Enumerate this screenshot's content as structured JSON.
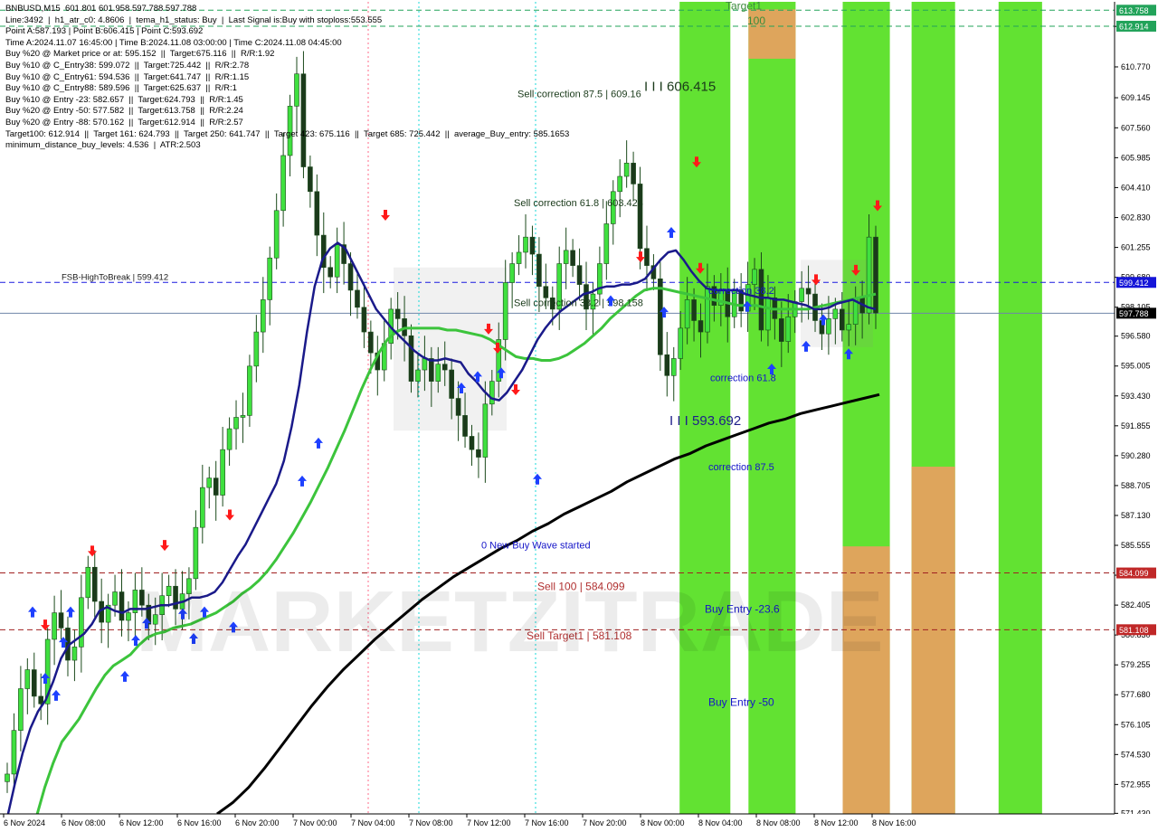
{
  "info_panel": {
    "lines": [
      "BNBUSD,M15  601.801 601.958 597.788 597.788",
      "Line:3492  |  h1_atr_c0: 4.8606  |  tema_h1_status: Buy  |  Last Signal is:Buy with stoploss:553.555",
      "Point A:587.193 | Point B:606.415 | Point C:593.692",
      "Time A:2024.11.07 16:45:00 | Time B:2024.11.08 03:00:00 | Time C:2024.11.08 04:45:00",
      "Buy %20 @ Market price or at: 595.152  ||  Target:675.116  ||  R/R:1.92",
      "Buy %10 @ C_Entry38: 599.072  ||  Target:725.442  ||  R/R:2.78",
      "Buy %10 @ C_Entry61: 594.536  ||  Target:641.747  ||  R/R:1.15",
      "Buy %10 @ C_Entry88: 589.596  ||  Target:625.637  ||  R/R:1",
      "Buy %10 @ Entry -23: 582.657  ||  Target:624.793  ||  R/R:1.45",
      "Buy %20 @ Entry -50: 577.582  ||  Target:613.758  ||  R/R:2.24",
      "Buy %20 @ Entry -88: 570.162  ||  Target:612.914  ||  R/R:2.57",
      "Target100: 612.914  ||  Target 161: 624.793  ||  Target 250: 641.747  ||  Target 423: 675.116  ||  Target 685: 725.442  ||  average_Buy_entry: 585.1653",
      "minimum_distance_buy_levels: 4.536  |  ATR:2.503"
    ]
  },
  "chart_data": {
    "type": "candlestick",
    "symbol": "BNBUSD,M15",
    "ylim": [
      571.4,
      614.2
    ],
    "x_ticks": [
      "6 Nov 2024",
      "6 Nov 08:00",
      "6 Nov 12:00",
      "6 Nov 16:00",
      "6 Nov 20:00",
      "7 Nov 00:00",
      "7 Nov 04:00",
      "7 Nov 08:00",
      "7 Nov 12:00",
      "7 Nov 16:00",
      "7 Nov 20:00",
      "8 Nov 00:00",
      "8 Nov 04:00",
      "8 Nov 08:00",
      "8 Nov 12:00",
      "8 Nov 16:00"
    ],
    "y_ticks": [
      "612.905",
      "610.770",
      "609.145",
      "607.560",
      "605.985",
      "604.410",
      "602.830",
      "601.255",
      "599.680",
      "598.105",
      "596.580",
      "595.005",
      "593.430",
      "591.855",
      "590.280",
      "588.705",
      "587.130",
      "585.555",
      "583.980",
      "582.405",
      "580.830",
      "579.255",
      "577.680",
      "576.105",
      "574.530",
      "572.955",
      "571.430"
    ],
    "price_tags": [
      {
        "value": 613.758,
        "label": "613.758",
        "color": "#22a35a"
      },
      {
        "value": 612.914,
        "label": "612.914",
        "color": "#22a35a"
      },
      {
        "value": 599.412,
        "label": "599.412",
        "color": "#1515d8"
      },
      {
        "value": 597.788,
        "label": "597.788",
        "color": "#000000"
      },
      {
        "value": 584.099,
        "label": "584.099",
        "color": "#c02828"
      },
      {
        "value": 581.108,
        "label": "581.108",
        "color": "#c02828"
      }
    ],
    "levels": [
      {
        "value": 613.758,
        "style": "dashed",
        "color": "#22a35a"
      },
      {
        "value": 612.914,
        "style": "dashed",
        "color": "#22a35a"
      },
      {
        "value": 599.412,
        "style": "dashed",
        "color": "#1a1ae0",
        "label": "FSB-HighToBreak | 599.412"
      },
      {
        "value": 597.788,
        "style": "solid",
        "color": "#6f86a8"
      },
      {
        "value": 584.099,
        "style": "dashed",
        "color": "#a02020"
      },
      {
        "value": 581.108,
        "style": "dashed",
        "color": "#a02020"
      }
    ],
    "annotations": [
      {
        "text": "Sell correction 87.5 | 609.16",
        "price": 609.16,
        "color": "#1a3a1a",
        "size": 11
      },
      {
        "text": "Sell correction 61.8 | 603.424",
        "price": 603.424,
        "color": "#1a3a1a",
        "size": 11
      },
      {
        "text": "Sell correction 38.2 | 598.158",
        "price": 598.158,
        "color": "#1a3a1a",
        "size": 11
      },
      {
        "text": "I I I 606.415",
        "price": 609.5,
        "color": "#1a3a1a",
        "size": 15
      },
      {
        "text": "I I I 593.692",
        "price": 591.9,
        "color": "#1e1e8a",
        "size": 15
      },
      {
        "text": "Target1",
        "price": 613.8,
        "color": "#3c8c3c",
        "size": 12
      },
      {
        "text": "100",
        "price": 613.0,
        "color": "#3c8c3c",
        "size": 12
      },
      {
        "text": "correction 38.2",
        "price": 598.8,
        "color": "#1515c8",
        "size": 11
      },
      {
        "text": "correction 61.8",
        "price": 594.2,
        "color": "#1515c8",
        "size": 11
      },
      {
        "text": "correction 87.5",
        "price": 589.5,
        "color": "#1515c8",
        "size": 11
      },
      {
        "text": "0 New Buy Wave started",
        "price": 585.4,
        "color": "#1515c8",
        "size": 11
      },
      {
        "text": "Sell 100 | 584.099",
        "price": 583.2,
        "color": "#b03030",
        "size": 12
      },
      {
        "text": "Sell Target1 | 581.108",
        "price": 580.6,
        "color": "#b03030",
        "size": 12
      },
      {
        "text": "Buy Entry -23.6",
        "price": 582.0,
        "color": "#1515c8",
        "size": 12
      },
      {
        "text": "Buy Entry -50",
        "price": 577.1,
        "color": "#1515c8",
        "size": 12
      }
    ],
    "zones": [
      {
        "from": 9,
        "to": 9.7,
        "color": "#55e021"
      },
      {
        "from": 9.95,
        "to": 10.6,
        "color": "#55e021"
      },
      {
        "from": 11.25,
        "to": 11.9,
        "color": "#55e021"
      },
      {
        "from": 12.2,
        "to": 12.8,
        "color": "#55e021"
      },
      {
        "from": 13.4,
        "to": 14.0,
        "color": "#55e021"
      },
      {
        "from": 9.95,
        "to": 10.6,
        "color": "#e8a060",
        "top": 613.8,
        "bottom": 611.2
      },
      {
        "from": 11.25,
        "to": 11.9,
        "color": "#e8a060",
        "top": 585.5,
        "bottom": 571.4
      },
      {
        "from": 12.2,
        "to": 12.8,
        "color": "#e8a060",
        "top": 589.7,
        "bottom": 571.4
      }
    ],
    "close": [
      573.5,
      575.8,
      578.0,
      579.0,
      577.6,
      577.2,
      580.6,
      582.0,
      581.2,
      579.5,
      580.2,
      582.8,
      584.4,
      582.6,
      581.5,
      582.4,
      583.1,
      581.6,
      582.0,
      583.2,
      582.4,
      581.4,
      581.9,
      582.9,
      583.4,
      582.2,
      583.0,
      583.8,
      586.5,
      588.6,
      589.1,
      588.2,
      590.6,
      591.7,
      592.3,
      592.4,
      595.0,
      596.8,
      598.5,
      600.7,
      603.2,
      606.1,
      608.7,
      610.4,
      605.5,
      604.2,
      601.9,
      600.2,
      599.7,
      601.4,
      600.4,
      599.0,
      598.1,
      596.8,
      595.7,
      594.8,
      596.2,
      598.0,
      597.5,
      596.6,
      594.2,
      594.8,
      595.4,
      594.2,
      595.1,
      594.8,
      593.3,
      592.4,
      591.3,
      590.6,
      590.2,
      593.0,
      594.2,
      596.4,
      599.4,
      600.4,
      601.0,
      601.8,
      600.9,
      599.2,
      598.6,
      598.0,
      600.4,
      601.1,
      600.3,
      599.3,
      598.0,
      598.8,
      600.4,
      602.5,
      604.2,
      605.0,
      605.7,
      604.6,
      601.2,
      600.3,
      599.6,
      595.6,
      594.5,
      595.4,
      597.0,
      598.5,
      597.4,
      596.8,
      599.2,
      598.2,
      599.0,
      597.6,
      599.0,
      597.9,
      599.3,
      600.1,
      596.9,
      598.6,
      597.5,
      596.3,
      597.6,
      598.4,
      599.1,
      598.8,
      597.4,
      596.7,
      597.5,
      598.0,
      596.9,
      597.2,
      598.6,
      597.8,
      601.8,
      597.8
    ],
    "tema_line": [
      571.2,
      573.0,
      574.6,
      575.9,
      576.8,
      577.4,
      578.4,
      579.6,
      580.3,
      580.6,
      580.9,
      581.4,
      582.1,
      582.3,
      582.1,
      582.0,
      582.2,
      582.2,
      582.2,
      582.3,
      582.4,
      582.4,
      582.5,
      582.6,
      582.8,
      582.8,
      582.9,
      583.1,
      583.6,
      584.3,
      585.0,
      585.6,
      586.4,
      587.2,
      588.0,
      588.8,
      590.0,
      591.8,
      594.0,
      596.8,
      599.2,
      600.6,
      601.2,
      601.5,
      601.2,
      600.4,
      599.6,
      598.8,
      598.0,
      597.5,
      597.0,
      596.6,
      596.2,
      595.8,
      595.5,
      595.3,
      595.3,
      595.4,
      595.3,
      595.2,
      594.6,
      594.2,
      593.7,
      593.3,
      593.2,
      593.6,
      594.2,
      594.8,
      595.6,
      596.4,
      597.0,
      597.5,
      597.9,
      598.2,
      598.5,
      598.8,
      598.9,
      599.1,
      599.2,
      599.2,
      599.3,
      599.3,
      599.4,
      599.6,
      600.1,
      600.6,
      601.0,
      601.1,
      600.6,
      600.0,
      599.5,
      599.1,
      599.0,
      599.0,
      599.0,
      599.0,
      598.8,
      598.7,
      598.6,
      598.6,
      598.5,
      598.5,
      598.4,
      598.3,
      598.2,
      598.0,
      598.0,
      598.1,
      598.3,
      598.4,
      598.5,
      598.3,
      598.1,
      598.0
    ],
    "green_ma": [
      571.2,
      572.8,
      574.1,
      575.2,
      575.8,
      576.4,
      577.2,
      578.0,
      578.7,
      579.2,
      579.5,
      579.8,
      580.3,
      580.7,
      580.9,
      581.0,
      581.2,
      581.3,
      581.4,
      581.6,
      581.8,
      582.0,
      582.3,
      582.6,
      583.0,
      583.3,
      583.7,
      584.2,
      584.8,
      585.5,
      586.2,
      587.0,
      587.8,
      588.7,
      589.6,
      590.6,
      591.6,
      592.7,
      593.8,
      594.8,
      595.7,
      596.4,
      596.8,
      597.0,
      597.0,
      597.0,
      597.0,
      597.0,
      596.9,
      596.9,
      596.8,
      596.7,
      596.6,
      596.4,
      596.1,
      595.8,
      595.5,
      595.4,
      595.4,
      595.3,
      595.3,
      595.4,
      595.6,
      595.9,
      596.2,
      596.6,
      597.0,
      597.5,
      597.9,
      598.3,
      598.7,
      599.0,
      599.1,
      599.1,
      599.0,
      598.9,
      598.8,
      598.7,
      598.6,
      598.5,
      598.4,
      598.3,
      598.2,
      598.2,
      598.2,
      598.1,
      598.0,
      598.0,
      598.0,
      598.0,
      598.0,
      598.1,
      598.2,
      598.3,
      598.4,
      598.5,
      598.6,
      598.7,
      598.8
    ],
    "black_ma": [
      571.4,
      572.0,
      572.8,
      573.8,
      574.9,
      576.0,
      577.1,
      578.1,
      579.0,
      579.8,
      580.6,
      581.3,
      582.0,
      582.7,
      583.3,
      583.9,
      584.4,
      584.9,
      585.4,
      585.8,
      586.3,
      586.7,
      587.2,
      587.6,
      588.0,
      588.4,
      588.9,
      589.3,
      589.7,
      590.1,
      590.4,
      590.8,
      591.1,
      591.4,
      591.7,
      592.0,
      592.2,
      592.5,
      592.7,
      592.9,
      593.1,
      593.3,
      593.5
    ]
  }
}
